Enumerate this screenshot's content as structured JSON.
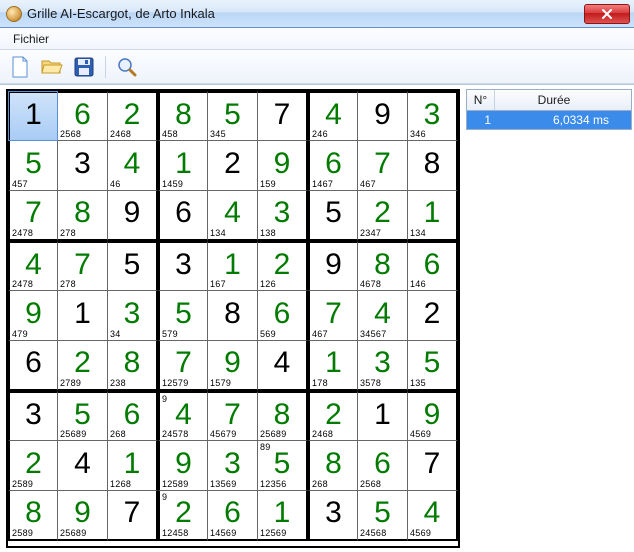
{
  "window": {
    "title": "Grille AI-Escargot, de Arto Inkala"
  },
  "menubar": {
    "file": "Fichier"
  },
  "toolbar": {
    "new": "new-file",
    "open": "open-folder",
    "save": "save-disk",
    "search": "magnifier"
  },
  "side": {
    "columns": [
      {
        "key": "num",
        "label": "N°",
        "width": 28
      },
      {
        "key": "duration",
        "label": "Durée",
        "width": 118
      }
    ],
    "rows": [
      {
        "num": "1",
        "duration": "6,0334 ms"
      }
    ]
  },
  "selected_cell": 0,
  "grid": [
    {
      "v": "1",
      "c": "black",
      "b": "",
      "t": ""
    },
    {
      "v": "6",
      "c": "green",
      "b": "2568",
      "t": ""
    },
    {
      "v": "2",
      "c": "green",
      "b": "2468",
      "t": ""
    },
    {
      "v": "8",
      "c": "green",
      "b": "458",
      "t": ""
    },
    {
      "v": "5",
      "c": "green",
      "b": "345",
      "t": ""
    },
    {
      "v": "7",
      "c": "black",
      "b": "",
      "t": ""
    },
    {
      "v": "4",
      "c": "green",
      "b": "246",
      "t": ""
    },
    {
      "v": "9",
      "c": "black",
      "b": "",
      "t": ""
    },
    {
      "v": "3",
      "c": "green",
      "b": "346",
      "t": ""
    },
    {
      "v": "5",
      "c": "green",
      "b": "457",
      "t": ""
    },
    {
      "v": "3",
      "c": "black",
      "b": "",
      "t": ""
    },
    {
      "v": "4",
      "c": "green",
      "b": "46",
      "t": ""
    },
    {
      "v": "1",
      "c": "green",
      "b": "1459",
      "t": ""
    },
    {
      "v": "2",
      "c": "black",
      "b": "",
      "t": ""
    },
    {
      "v": "9",
      "c": "green",
      "b": "159",
      "t": ""
    },
    {
      "v": "6",
      "c": "green",
      "b": "1467",
      "t": ""
    },
    {
      "v": "7",
      "c": "green",
      "b": "467",
      "t": ""
    },
    {
      "v": "8",
      "c": "black",
      "b": "",
      "t": ""
    },
    {
      "v": "7",
      "c": "green",
      "b": "2478",
      "t": ""
    },
    {
      "v": "8",
      "c": "green",
      "b": "278",
      "t": ""
    },
    {
      "v": "9",
      "c": "black",
      "b": "",
      "t": ""
    },
    {
      "v": "6",
      "c": "black",
      "b": "",
      "t": ""
    },
    {
      "v": "4",
      "c": "green",
      "b": "134",
      "t": ""
    },
    {
      "v": "3",
      "c": "green",
      "b": "138",
      "t": ""
    },
    {
      "v": "5",
      "c": "black",
      "b": "",
      "t": ""
    },
    {
      "v": "2",
      "c": "green",
      "b": "2347",
      "t": ""
    },
    {
      "v": "1",
      "c": "green",
      "b": "134",
      "t": ""
    },
    {
      "v": "4",
      "c": "green",
      "b": "2478",
      "t": ""
    },
    {
      "v": "7",
      "c": "green",
      "b": "278",
      "t": ""
    },
    {
      "v": "5",
      "c": "black",
      "b": "",
      "t": ""
    },
    {
      "v": "3",
      "c": "black",
      "b": "",
      "t": ""
    },
    {
      "v": "1",
      "c": "green",
      "b": "167",
      "t": ""
    },
    {
      "v": "2",
      "c": "green",
      "b": "126",
      "t": ""
    },
    {
      "v": "9",
      "c": "black",
      "b": "",
      "t": ""
    },
    {
      "v": "8",
      "c": "green",
      "b": "4678",
      "t": ""
    },
    {
      "v": "6",
      "c": "green",
      "b": "146",
      "t": ""
    },
    {
      "v": "9",
      "c": "green",
      "b": "479",
      "t": ""
    },
    {
      "v": "1",
      "c": "black",
      "b": "",
      "t": ""
    },
    {
      "v": "3",
      "c": "green",
      "b": "34",
      "t": ""
    },
    {
      "v": "5",
      "c": "green",
      "b": "579",
      "t": ""
    },
    {
      "v": "8",
      "c": "black",
      "b": "",
      "t": ""
    },
    {
      "v": "6",
      "c": "green",
      "b": "569",
      "t": ""
    },
    {
      "v": "7",
      "c": "green",
      "b": "467",
      "t": ""
    },
    {
      "v": "4",
      "c": "green",
      "b": "34567",
      "t": ""
    },
    {
      "v": "2",
      "c": "black",
      "b": "",
      "t": ""
    },
    {
      "v": "6",
      "c": "black",
      "b": "",
      "t": ""
    },
    {
      "v": "2",
      "c": "green",
      "b": "2789",
      "t": ""
    },
    {
      "v": "8",
      "c": "green",
      "b": "238",
      "t": ""
    },
    {
      "v": "7",
      "c": "green",
      "b": "12579",
      "t": ""
    },
    {
      "v": "9",
      "c": "green",
      "b": "1579",
      "t": ""
    },
    {
      "v": "4",
      "c": "black",
      "b": "",
      "t": ""
    },
    {
      "v": "1",
      "c": "green",
      "b": "178",
      "t": ""
    },
    {
      "v": "3",
      "c": "green",
      "b": "3578",
      "t": ""
    },
    {
      "v": "5",
      "c": "green",
      "b": "135",
      "t": ""
    },
    {
      "v": "3",
      "c": "black",
      "b": "",
      "t": ""
    },
    {
      "v": "5",
      "c": "green",
      "b": "25689",
      "t": ""
    },
    {
      "v": "6",
      "c": "green",
      "b": "268",
      "t": ""
    },
    {
      "v": "4",
      "c": "green",
      "b": "24578",
      "t": "9"
    },
    {
      "v": "7",
      "c": "green",
      "b": "45679",
      "t": ""
    },
    {
      "v": "8",
      "c": "green",
      "b": "25689",
      "t": ""
    },
    {
      "v": "2",
      "c": "green",
      "b": "2468",
      "t": ""
    },
    {
      "v": "1",
      "c": "black",
      "b": "",
      "t": ""
    },
    {
      "v": "9",
      "c": "green",
      "b": "4569",
      "t": ""
    },
    {
      "v": "2",
      "c": "green",
      "b": "2589",
      "t": ""
    },
    {
      "v": "4",
      "c": "black",
      "b": "",
      "t": ""
    },
    {
      "v": "1",
      "c": "green",
      "b": "1268",
      "t": ""
    },
    {
      "v": "9",
      "c": "green",
      "b": "12589",
      "t": ""
    },
    {
      "v": "3",
      "c": "green",
      "b": "13569",
      "t": ""
    },
    {
      "v": "5",
      "c": "green",
      "b": "12356",
      "t": "89"
    },
    {
      "v": "8",
      "c": "green",
      "b": "268",
      "t": ""
    },
    {
      "v": "6",
      "c": "green",
      "b": "2568",
      "t": ""
    },
    {
      "v": "7",
      "c": "black",
      "b": "",
      "t": ""
    },
    {
      "v": "8",
      "c": "green",
      "b": "2589",
      "t": ""
    },
    {
      "v": "9",
      "c": "green",
      "b": "25689",
      "t": ""
    },
    {
      "v": "7",
      "c": "black",
      "b": "",
      "t": ""
    },
    {
      "v": "2",
      "c": "green",
      "b": "12458",
      "t": "9"
    },
    {
      "v": "6",
      "c": "green",
      "b": "14569",
      "t": ""
    },
    {
      "v": "1",
      "c": "green",
      "b": "12569",
      "t": ""
    },
    {
      "v": "3",
      "c": "black",
      "b": "",
      "t": ""
    },
    {
      "v": "5",
      "c": "green",
      "b": "24568",
      "t": ""
    },
    {
      "v": "4",
      "c": "green",
      "b": "4569",
      "t": ""
    }
  ]
}
